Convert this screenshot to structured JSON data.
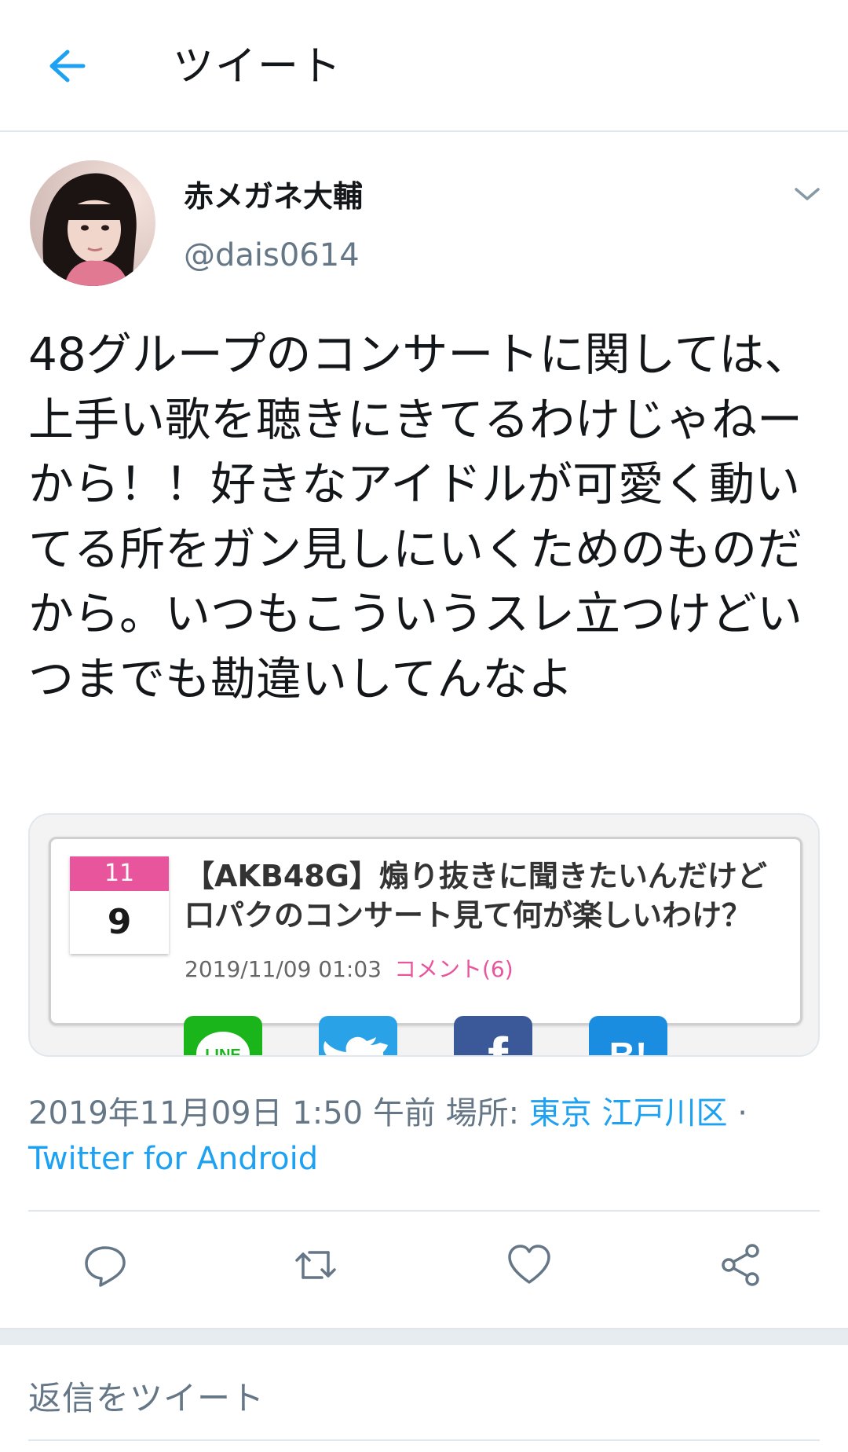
{
  "header": {
    "title": "ツイート"
  },
  "tweet": {
    "display_name": "赤メガネ大輔",
    "handle": "@dais0614",
    "text": "48グループのコンサートに関しては、上手い歌を聴きにきてるわけじゃねーから！！好きなアイドルが可愛く動いてる所をガン見しにいくためのものだから。いつもこういうスレ立つけどいつまでも勘違いしてんなよ",
    "card": {
      "calendar_month": "11",
      "calendar_day": "9",
      "title": "【AKB48G】煽り抜きに聞きたいんだけど口パクのコンサート見て何が楽しいわけ？",
      "date": "2019/11/09 01:03",
      "comment_link": "コメント(6)",
      "share_buttons": {
        "line": "LINE",
        "twitter": "twitter",
        "facebook": "f",
        "hatena": "B!"
      }
    },
    "timestamp": "2019年11月09日 1:50 午前",
    "location_label": "場所:",
    "location_value": "東京 江戸川区",
    "separator": "·",
    "source": "Twitter for Android"
  },
  "reply": {
    "placeholder": "返信をツイート"
  },
  "colors": {
    "accent": "#1da1f2",
    "text": "#14171a",
    "secondary": "#657786",
    "divider": "#e1e8ed",
    "calendar_pink": "#e8559d"
  },
  "icons": {
    "back": "arrow-left-icon",
    "caret": "chevron-down-icon",
    "reply": "comment-bubble-icon",
    "retweet": "retweet-icon",
    "like": "heart-icon",
    "share": "share-icon"
  }
}
